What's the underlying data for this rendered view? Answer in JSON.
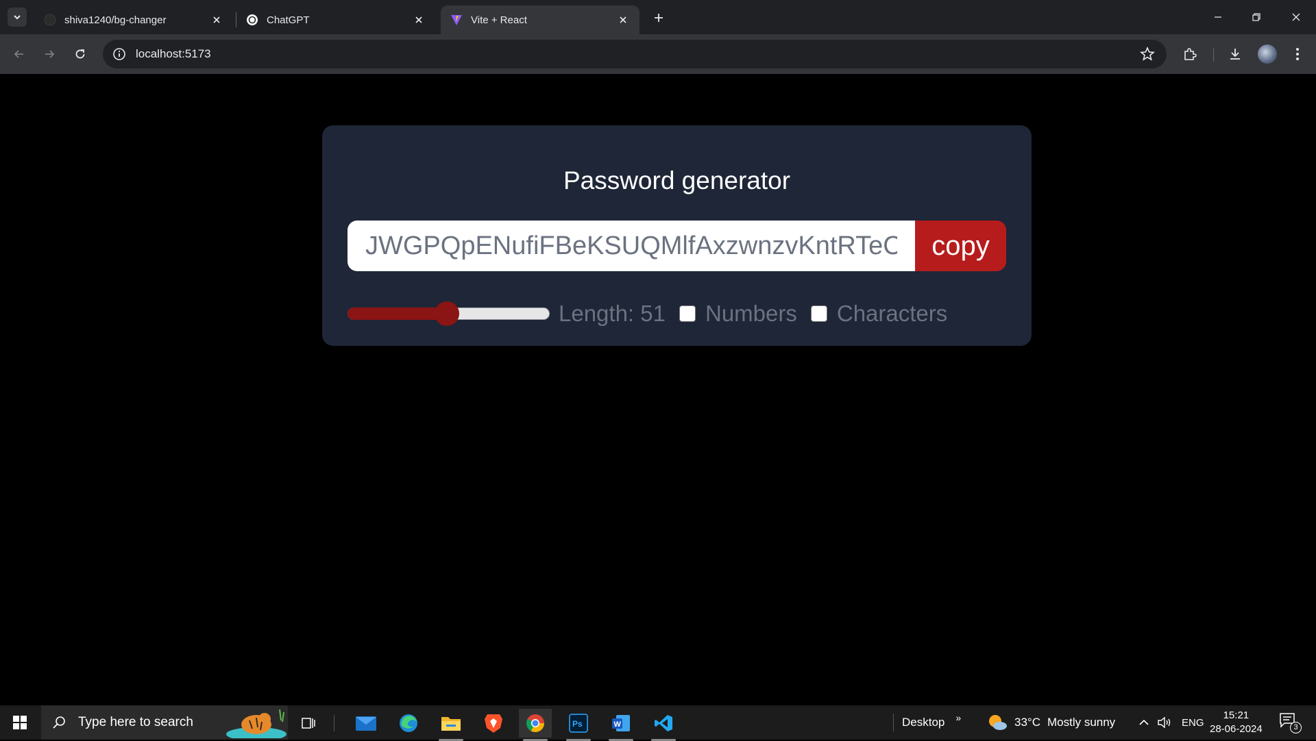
{
  "browser": {
    "tabs": [
      {
        "title": "shiva1240/bg-changer",
        "active": false,
        "favicon": "github-icon"
      },
      {
        "title": "ChatGPT",
        "active": false,
        "favicon": "chatgpt-icon"
      },
      {
        "title": "Vite + React",
        "active": true,
        "favicon": "vite-icon"
      }
    ],
    "url": "localhost:5173"
  },
  "app": {
    "title": "Password generator",
    "password": "JWGPQpENufiFBeKSUQMlfAxzwnzvKntRTeClSeeYbHqLrGoXaVdPiWuMjTs",
    "copy_label": "copy",
    "length_label": "Length: 51",
    "length_value": 51,
    "slider_fraction": 0.49,
    "numbers_label": "Numbers",
    "numbers_checked": false,
    "characters_label": "Characters",
    "characters_checked": false,
    "accent_color": "#b71c1c"
  },
  "taskbar": {
    "search_placeholder": "Type here to search",
    "desktop_label": "Desktop",
    "chevron": "»",
    "weather_temp": "33°C",
    "weather_text": "Mostly sunny",
    "language": "ENG",
    "time": "15:21",
    "date": "28-06-2024",
    "notification_count": "3"
  }
}
